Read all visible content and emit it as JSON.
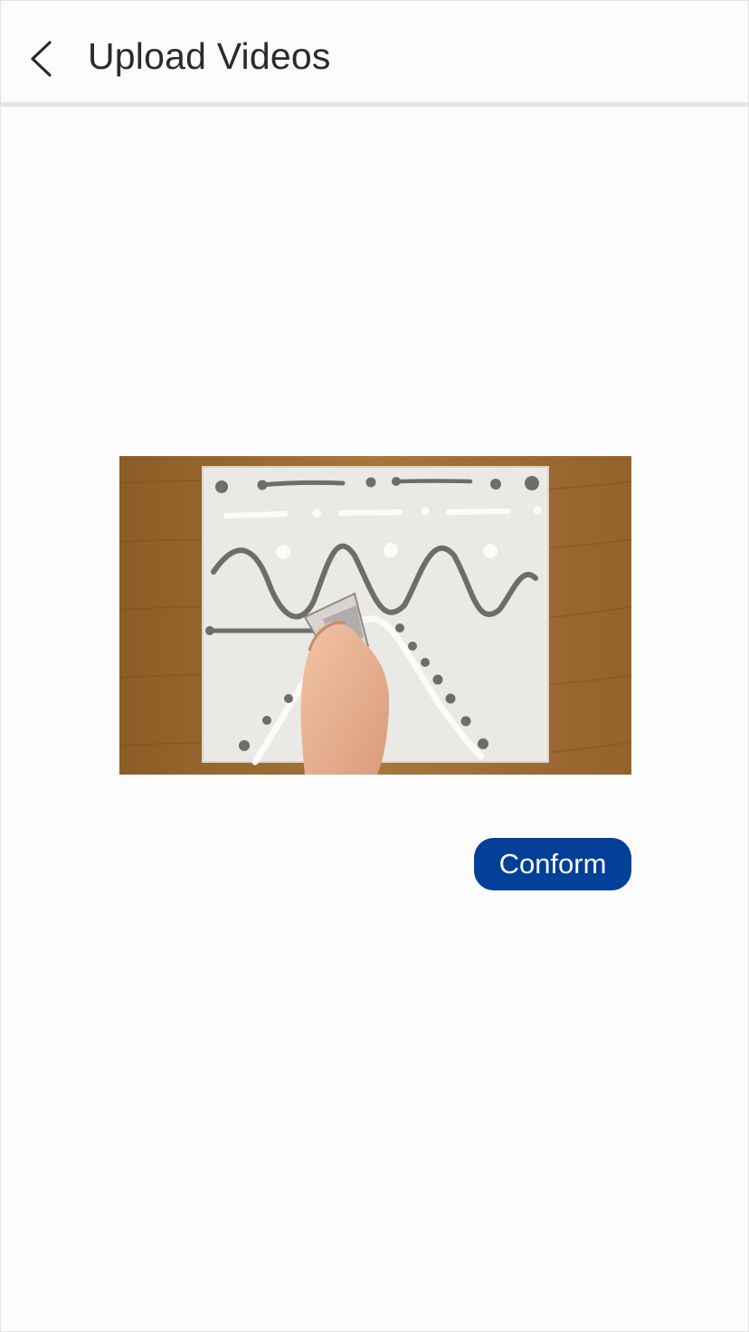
{
  "header": {
    "back_icon": "chevron-left-icon",
    "title": "Upload Videos"
  },
  "video": {
    "subject": "hand spreading paint on canvas",
    "colors": {
      "table": "#9c6a30",
      "canvas": "#ebe9e6",
      "paint_gray": "#6f6c6c",
      "paint_white": "#fbfbf9"
    }
  },
  "actions": {
    "confirm_label": "Conform"
  },
  "colors": {
    "accent": "#023f98",
    "background": "#fcfcfc",
    "divider": "#e4e4e4",
    "title_text": "#2b2b2b"
  }
}
